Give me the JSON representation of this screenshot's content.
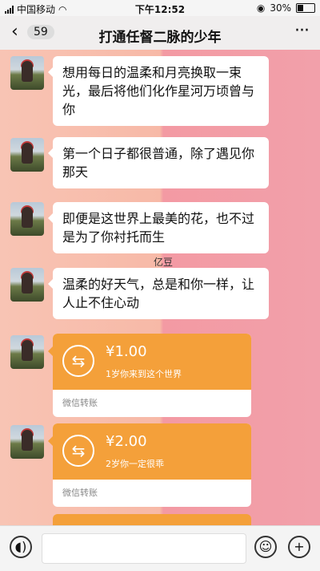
{
  "status": {
    "carrier": "中国移动",
    "time": "下午12:52",
    "battery": "30%",
    "battery_level": 0.3
  },
  "nav": {
    "back_icon": "back-chevron-icon",
    "unread": "59",
    "title": "打通任督二脉的少年",
    "more": "···"
  },
  "messages": [
    {
      "text": "想用每日的温柔和月亮换取一束光，最后将他们化作星河万顷曾与你"
    },
    {
      "text": "第一个日子都很普通，除了遇见你那天"
    },
    {
      "text": "即便是这世界上最美的花，也不过是为了你衬托而生"
    },
    {
      "text": "温柔的好天气，总是和你一样，让人止不住心动"
    }
  ],
  "watermark": "亿豆",
  "transfers": [
    {
      "amount": "¥1.00",
      "memo": "1岁你来到这个世界",
      "label": "微信转账"
    },
    {
      "amount": "¥2.00",
      "memo": "2岁你一定很乖",
      "label": "微信转账"
    }
  ],
  "input": {
    "voice_icon": "voice-icon",
    "emoji_icon": "emoji-icon",
    "plus_icon": "plus-icon"
  }
}
